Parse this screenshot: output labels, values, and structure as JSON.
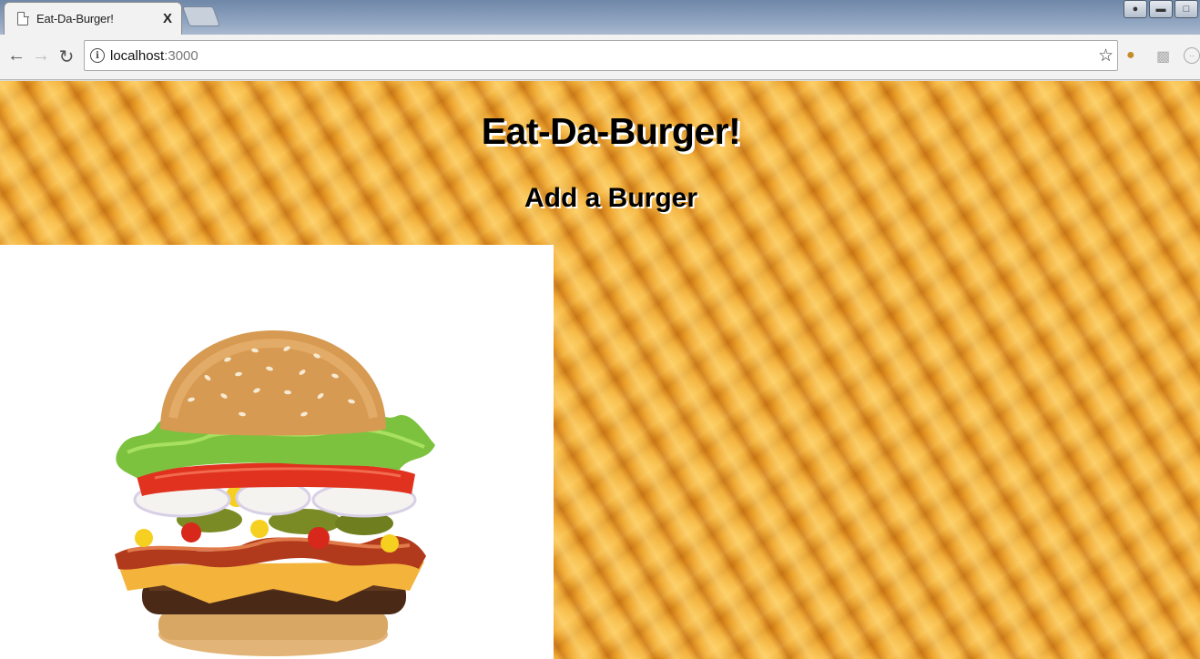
{
  "browser": {
    "tab_title": "Eat-Da-Burger!",
    "tab_close": "X",
    "url_host": "localhost",
    "url_port": ":3000",
    "icons": [
      "back-icon",
      "forward-icon",
      "reload-icon",
      "info-icon",
      "star-icon",
      "cookie-icon",
      "lock-icon",
      "extension-icon"
    ],
    "window_controls": [
      "user",
      "minimize",
      "restore"
    ]
  },
  "page": {
    "title": "Eat-Da-Burger!",
    "section_title": "Add a Burger",
    "background": "french-fries",
    "image": "burger"
  },
  "colors": {
    "title_text": "#000000",
    "title_shadow": "#ffffff",
    "panel": "#ffffff",
    "fries": "#e79a20"
  }
}
